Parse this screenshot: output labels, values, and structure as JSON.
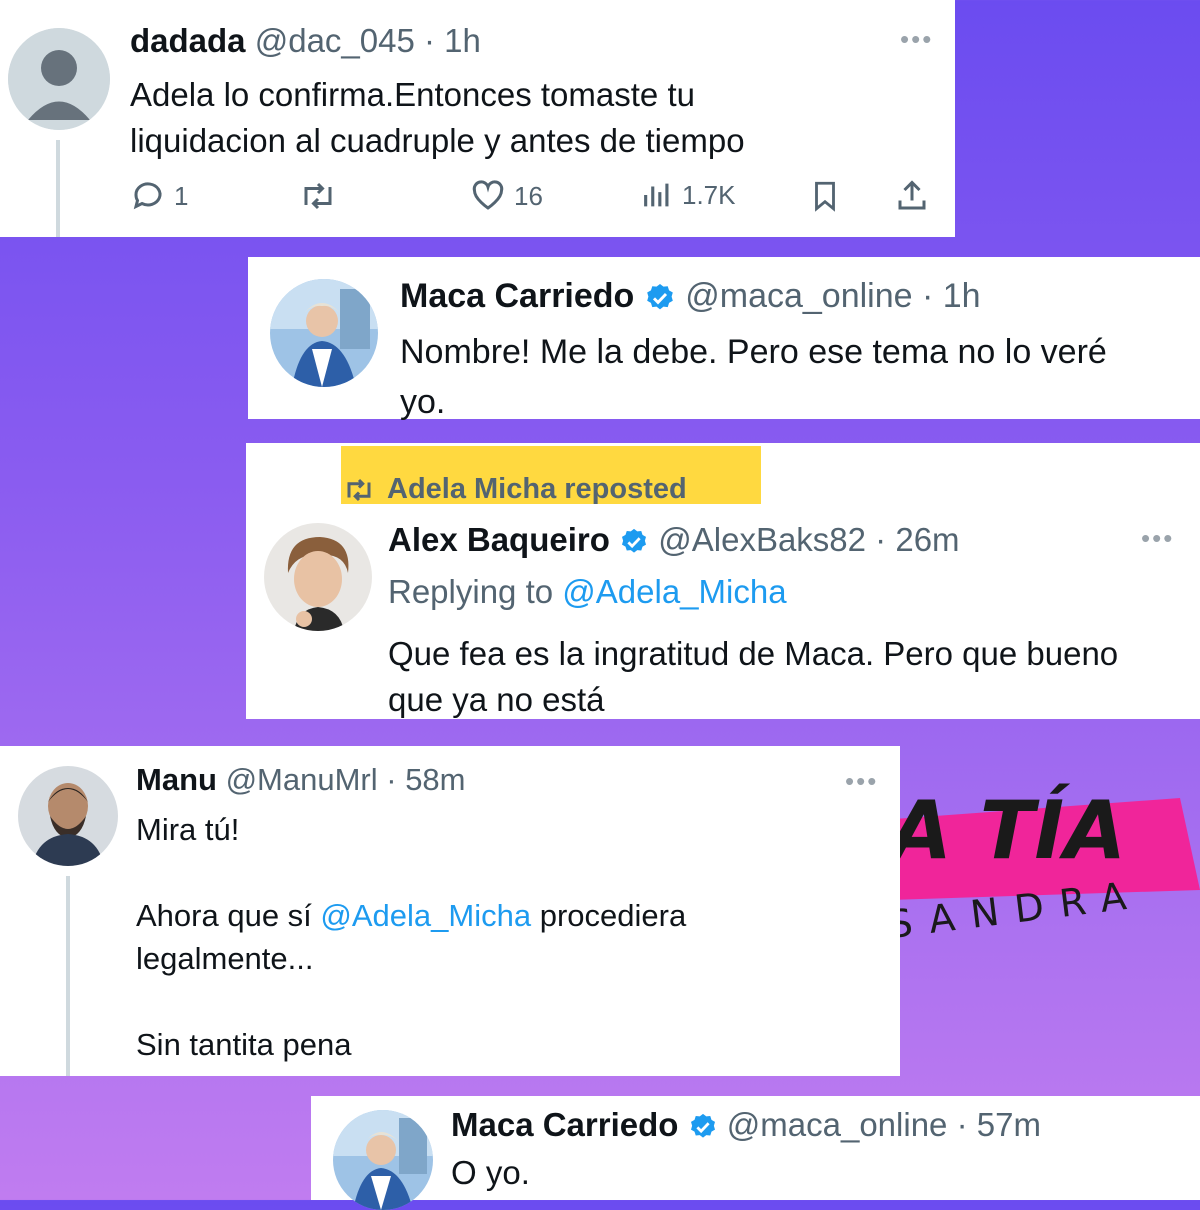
{
  "tweets": [
    {
      "name": "dadada",
      "handle": "@dac_045",
      "time": "1h",
      "lines": [
        "Adela lo confirma.Entonces tomaste tu",
        "liquidacion al cuadruple y antes de tiempo"
      ],
      "actions": {
        "replies": "1",
        "likes": "16",
        "views": "1.7K"
      }
    },
    {
      "name": "Maca Carriedo",
      "handle": "@maca_online",
      "time": "1h",
      "lines": [
        "Nombre! Me la debe. Pero ese tema no lo veré",
        "yo."
      ]
    },
    {
      "repost_label": "Adela Micha reposted",
      "name": "Alex Baqueiro",
      "handle": "@AlexBaks82",
      "time": "26m",
      "replying_prefix": "Replying to",
      "replying_handle": "@Adela_Micha",
      "lines": [
        "Que fea es la ingratitud de Maca. Pero que bueno",
        "que ya no está"
      ]
    },
    {
      "name": "Manu",
      "handle": "@ManuMrl",
      "time": "58m",
      "line1": "Mira tú!",
      "line2_pre": "Ahora que sí ",
      "line2_mention": "@Adela_Micha",
      "line2_post": " procediera",
      "line3": "legalmente...",
      "line4": "Sin tantita pena"
    },
    {
      "name": "Maca Carriedo",
      "handle": "@maca_online",
      "time": "57m",
      "lines": [
        "O yo."
      ]
    }
  ],
  "logo": {
    "top": "A TÍA",
    "bottom": "SANDRA"
  },
  "icons": [
    "reply-icon",
    "retweet-icon",
    "like-icon",
    "views-icon",
    "bookmark-icon",
    "share-icon",
    "verified-icon",
    "more-icon"
  ],
  "colors": {
    "link": "#1d9bf0",
    "verified": "#1d9bf0",
    "highlight": "#ffd21f",
    "logo_pink": "#f0259a"
  }
}
